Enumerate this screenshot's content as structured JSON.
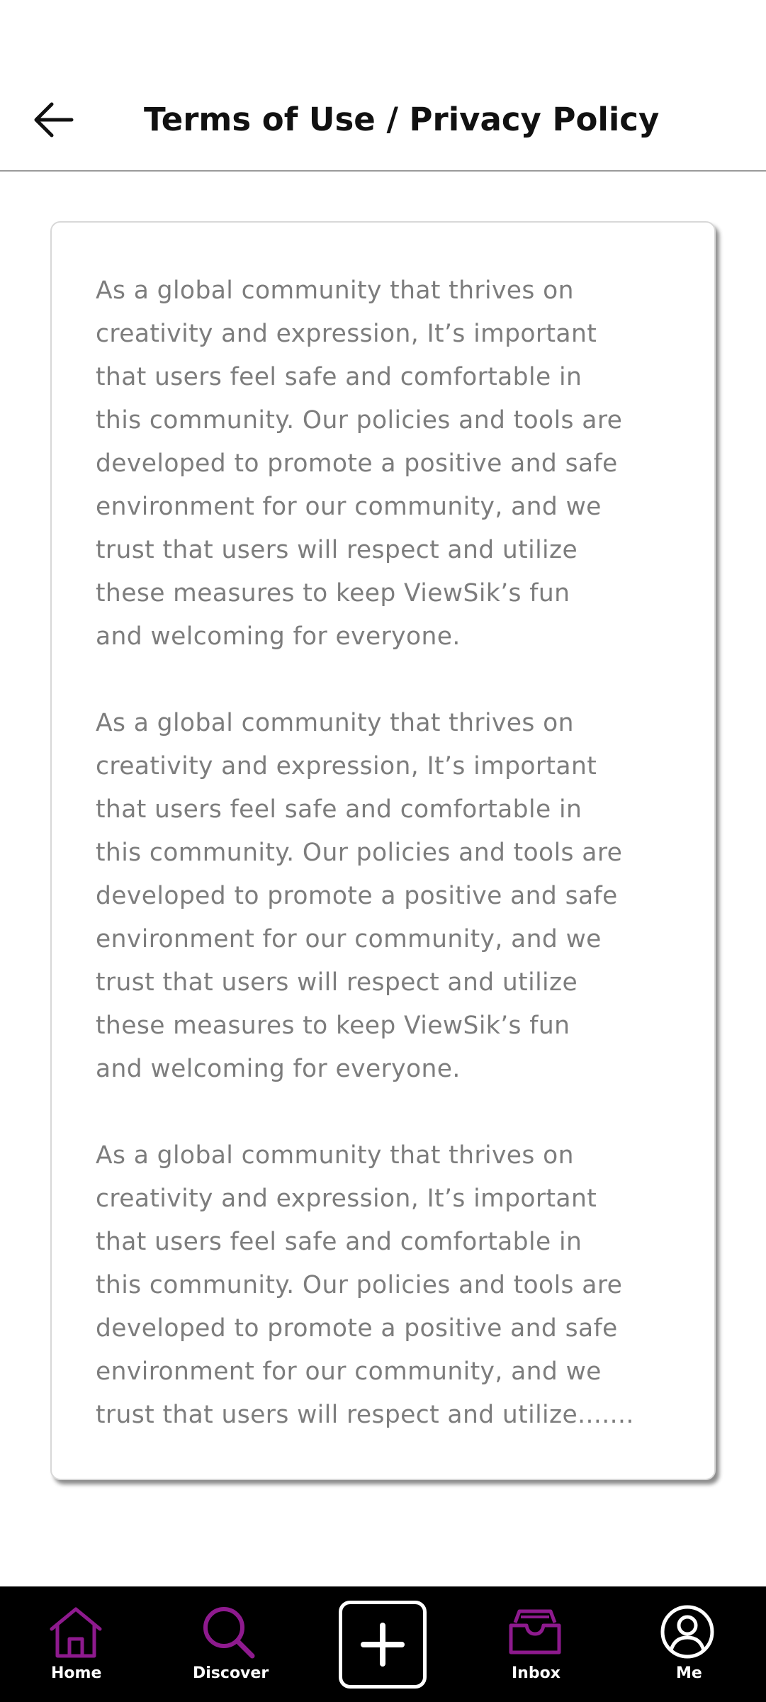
{
  "header": {
    "back_icon": "arrow-left-icon",
    "title": "Terms of Use / Privacy Policy"
  },
  "content": {
    "paragraphs": [
      "As a global community that thrives on\ncreativity and expression, It’s important\nthat users feel safe and comfortable in\nthis community. Our policies and tools are\ndeveloped to promote a positive and safe\nenvironment for our community, and we\ntrust that users will respect and utilize\nthese measures to keep ViewSik’s fun\nand welcoming for everyone.",
      "As a global community that thrives on\ncreativity and expression, It’s important\nthat users feel safe and comfortable in\nthis community. Our policies and tools are\ndeveloped to promote a positive and safe\nenvironment for our community, and we\ntrust that users will respect and utilize\nthese measures to keep ViewSik’s fun\nand welcoming for everyone.",
      "As a global community that thrives on\ncreativity and expression, It’s important\nthat users feel safe and comfortable in\nthis community. Our policies and tools are\ndeveloped to promote a positive and safe\nenvironment for our community, and we\ntrust that users will respect and utilize......."
    ]
  },
  "bottom_nav": {
    "items": [
      {
        "label": "Home",
        "icon": "home-icon"
      },
      {
        "label": "Discover",
        "icon": "search-icon"
      },
      {
        "label": "",
        "icon": "plus-icon"
      },
      {
        "label": "Inbox",
        "icon": "inbox-icon"
      },
      {
        "label": "Me",
        "icon": "user-icon"
      }
    ]
  },
  "colors": {
    "accent": "#8e1a8e",
    "text_muted": "#7d7d7d",
    "nav_background": "#000000"
  }
}
